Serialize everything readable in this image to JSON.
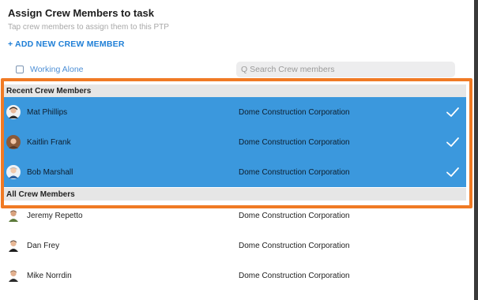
{
  "header": {
    "title": "Assign Crew Members to task",
    "subtitle": "Tap crew members to assign them to this PTP",
    "add_link": "+ ADD NEW CREW MEMBER"
  },
  "controls": {
    "working_alone_label": "Working Alone",
    "working_alone_checked": false,
    "search_placeholder": "Q Search Crew members"
  },
  "sections": {
    "recent_title": "Recent Crew Members",
    "all_title": "All Crew Members"
  },
  "recent_members": [
    {
      "name": "Mat Phillips",
      "company": "Dome Construction Corporation",
      "selected": true
    },
    {
      "name": "Kaitlin Frank",
      "company": "Dome Construction Corporation",
      "selected": true
    },
    {
      "name": "Bob Marshall",
      "company": "Dome Construction Corporation",
      "selected": true
    }
  ],
  "all_members": [
    {
      "name": "Jeremy Repetto",
      "company": "Dome Construction Corporation",
      "selected": false
    },
    {
      "name": "Dan Frey",
      "company": "Dome Construction Corporation",
      "selected": false
    },
    {
      "name": "Mike Norrdin",
      "company": "Dome Construction Corporation",
      "selected": false
    }
  ],
  "colors": {
    "accent": "#1f7fd6",
    "selected_row": "#3b98dd",
    "highlight_border": "#f07a24",
    "section_header": "#e6e6e6"
  },
  "icons": {
    "search": "search-icon",
    "check": "checkmark-icon",
    "checkbox": "checkbox-icon"
  }
}
